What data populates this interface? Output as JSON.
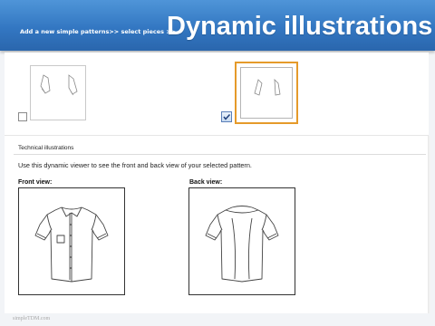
{
  "header": {
    "breadcrumb": "Add a new simple patterns>> select pieces >>",
    "title": "Dynamic illustrations"
  },
  "pieces": [
    {
      "name": "sleeves-piece-1",
      "checked": false
    },
    {
      "name": "sleeves-piece-2",
      "checked": true
    }
  ],
  "technical": {
    "title": "Technical illustrations",
    "description": "Use this dynamic viewer to see the front and back view of your selected pattern.",
    "front_label": "Front view:",
    "back_label": "Back view:"
  },
  "footer": {
    "text": "simpleTDM.com"
  },
  "colors": {
    "header_blue": "#3377c2",
    "selected_border": "#e59a2a"
  }
}
